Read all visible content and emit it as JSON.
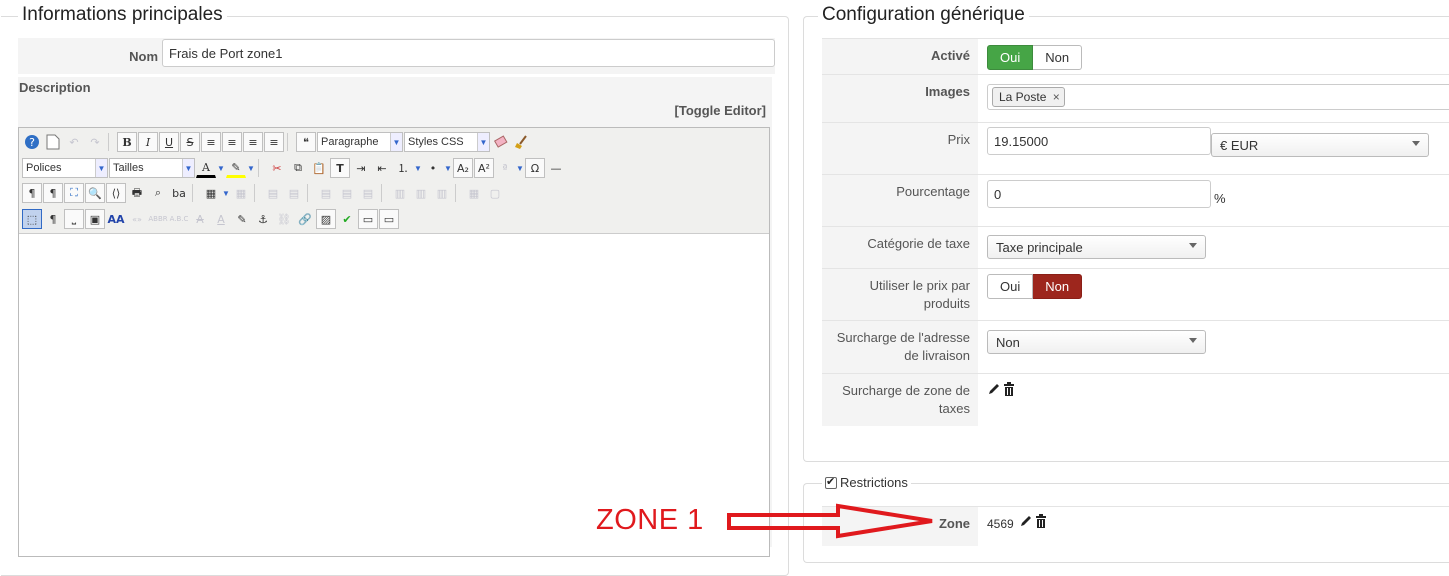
{
  "left": {
    "legend": "Informations principales",
    "nom_label": "Nom",
    "nom_value": "Frais de Port zone1",
    "description_label": "Description",
    "toggle_editor": "[Toggle Editor]",
    "toolbar": {
      "format_select": "Paragraphe",
      "styles_select": "Styles CSS",
      "fonts_select": "Polices",
      "sizes_select": "Tailles"
    }
  },
  "right": {
    "legend": "Configuration générique",
    "active": {
      "label": "Activé",
      "yes": "Oui",
      "no": "Non",
      "selected": "Oui"
    },
    "images": {
      "label": "Images",
      "tag": "La Poste"
    },
    "price": {
      "label": "Prix",
      "value": "19.15000",
      "currency": "€ EUR"
    },
    "percentage": {
      "label": "Pourcentage",
      "value": "0",
      "unit": "%"
    },
    "tax_category": {
      "label": "Catégorie de taxe",
      "value": "Taxe principale"
    },
    "use_product_price": {
      "label": "Utiliser le prix par produits",
      "yes": "Oui",
      "no": "Non",
      "selected": "Non"
    },
    "address_override": {
      "label": "Surcharge de l'adresse de livraison",
      "value": "Non"
    },
    "tax_zone_override": {
      "label": "Surcharge de zone de taxes"
    }
  },
  "restrictions": {
    "legend": "Restrictions",
    "zone_label": "Zone",
    "zone_value": "4569"
  },
  "annotation": {
    "text": "ZONE 1",
    "color": "#e0191d"
  }
}
